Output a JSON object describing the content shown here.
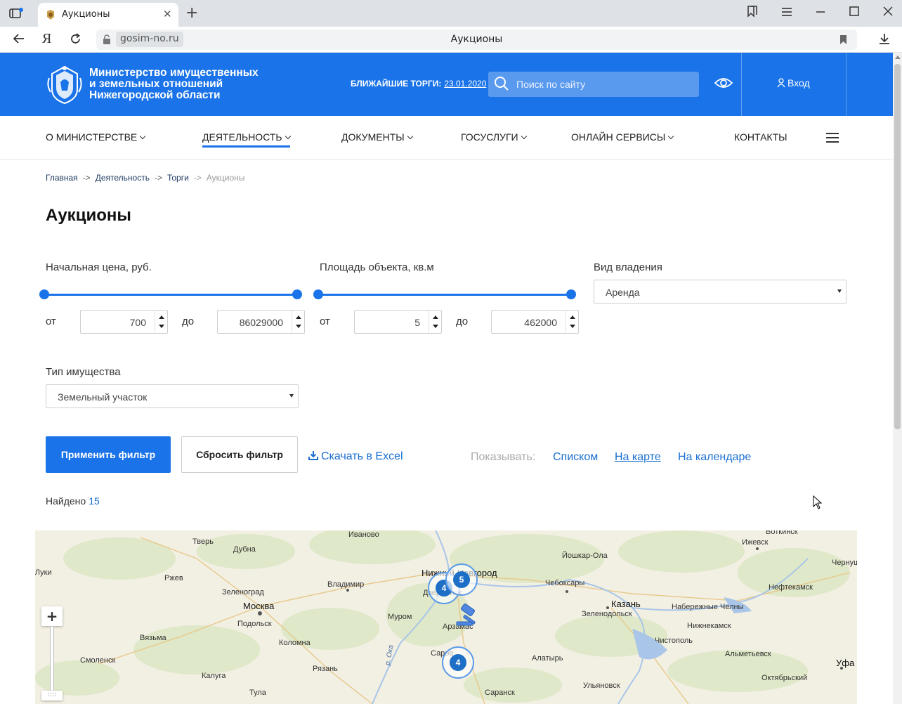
{
  "browser": {
    "tab_title": "Аукционы",
    "url_host": "gosim-no.ru",
    "page_title": "Аукционы"
  },
  "header": {
    "ministry_line1": "Министерство имущественных",
    "ministry_line2": "и земельных отношений",
    "ministry_line3": "Нижегородской области",
    "nearest_label": "БЛИЖАЙШИЕ ТОРГИ:",
    "nearest_date": "23.01.2020",
    "search_placeholder": "Поиск по сайту",
    "login_label": "Вход"
  },
  "menu": {
    "items": [
      {
        "label": "О МИНИСТЕРСТВЕ"
      },
      {
        "label": "ДЕЯТЕЛЬНОСТЬ"
      },
      {
        "label": "ДОКУМЕНТЫ"
      },
      {
        "label": "ГОСУСЛУГИ"
      },
      {
        "label": "ОНЛАЙН СЕРВИСЫ"
      },
      {
        "label": "КОНТАКТЫ"
      }
    ],
    "active": "ДЕЯТЕЛЬНОСТЬ"
  },
  "breadcrumb": {
    "items": [
      "Главная",
      "Деятельность",
      "Торги",
      "Аукционы"
    ],
    "sep": "->"
  },
  "title": "Аукционы",
  "filters": {
    "price": {
      "label": "Начальная цена, руб.",
      "from_word": "от",
      "to_word": "до",
      "from": "700",
      "to": "86029000"
    },
    "area": {
      "label": "Площадь объекта, кв.м",
      "from_word": "от",
      "to_word": "до",
      "from": "5",
      "to": "462000"
    },
    "ownership": {
      "label": "Вид владения",
      "value": "Аренда"
    },
    "property_type": {
      "label": "Тип имущества",
      "value": "Земельный участок"
    }
  },
  "actions": {
    "apply": "Применить фильтр",
    "reset": "Сбросить фильтр",
    "excel": "Скачать в Excel",
    "show_label": "Показывать:",
    "views": [
      "Списком",
      "На карте",
      "На календаре"
    ],
    "active_view": "На карте"
  },
  "found": {
    "label": "Найдено",
    "count": "15"
  },
  "map": {
    "cities": [
      "Тверь",
      "Дубна",
      "Иваново",
      "Ржев",
      "Зеленоград",
      "Москва",
      "Владимир",
      "Нижний Новгород",
      "Йошкар-Ола",
      "Чебоксары",
      "Ижевск",
      "Воткинск",
      "Чернушка",
      "Нефтекамск",
      "Набережные Челны",
      "Нижнекамск",
      "Казань",
      "Зеленодольск",
      "Подольск",
      "Муром",
      "Арзамас",
      "Вязьма",
      "Коломна",
      "Смоленск",
      "Рязань",
      "Калуга",
      "Тула",
      "Саранск",
      "Алатырь",
      "Ульяновск",
      "Чистополь",
      "Альметьевск",
      "Октябрьский",
      "Уфа",
      "Великие Луки",
      "Дзержинск",
      "Саров"
    ],
    "river_label": "р. Ока",
    "clusters": [
      "4",
      "5",
      "4"
    ],
    "zoom_in_label": "+"
  },
  "colors": {
    "brand": "#1a73e8",
    "link": "#1a6fd1",
    "cluster": "#1e6fc6"
  }
}
